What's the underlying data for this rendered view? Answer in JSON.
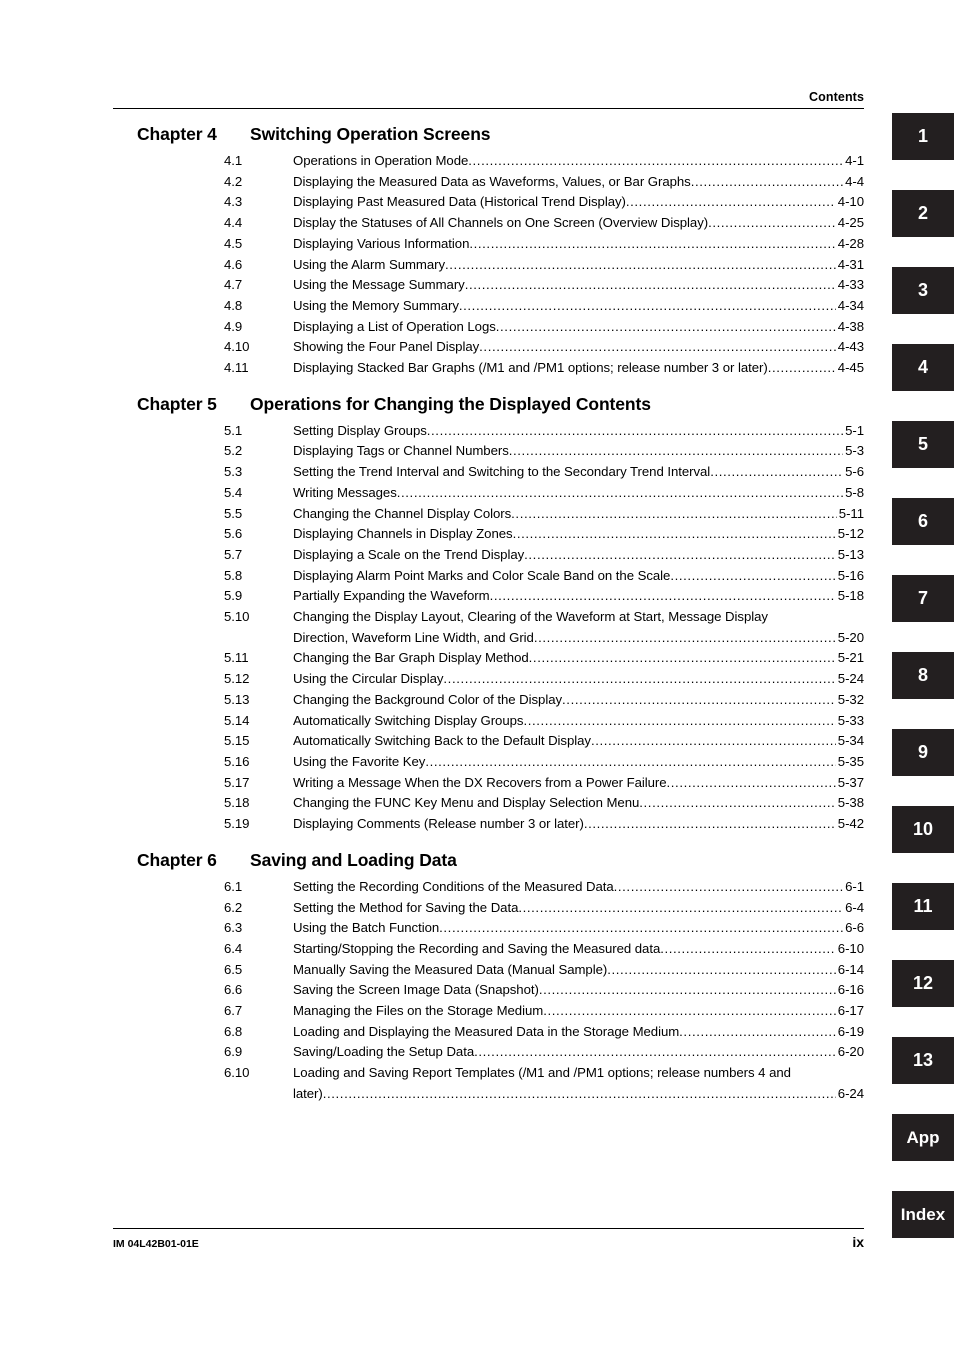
{
  "header": {
    "label": "Contents"
  },
  "footer": {
    "document_number": "IM 04L42B01-01E",
    "page_number": "ix"
  },
  "chapters": [
    {
      "number": "Chapter 4",
      "title": "Switching Operation Screens",
      "entries": [
        {
          "num": "4.1",
          "title": "Operations in Operation Mode",
          "page": "4-1"
        },
        {
          "num": "4.2",
          "title": "Displaying the Measured Data as Waveforms, Values, or Bar Graphs",
          "page": "4-4"
        },
        {
          "num": "4.3",
          "title": "Displaying Past Measured Data (Historical Trend Display)",
          "page": "4-10"
        },
        {
          "num": "4.4",
          "title": "Display the Statuses of All Channels on One Screen (Overview Display)",
          "page": "4-25"
        },
        {
          "num": "4.5",
          "title": "Displaying Various Information",
          "page": "4-28"
        },
        {
          "num": "4.6",
          "title": "Using the Alarm Summary",
          "page": "4-31"
        },
        {
          "num": "4.7",
          "title": "Using the Message Summary",
          "page": "4-33"
        },
        {
          "num": "4.8",
          "title": "Using the Memory Summary",
          "page": "4-34"
        },
        {
          "num": "4.9",
          "title": "Displaying a List of Operation Logs",
          "page": "4-38"
        },
        {
          "num": "4.10",
          "title": "Showing the Four Panel Display",
          "page": "4-43"
        },
        {
          "num": "4.11",
          "title": "Displaying Stacked Bar Graphs (/M1 and /PM1 options; release number 3 or later)",
          "page": "4-45"
        }
      ]
    },
    {
      "number": "Chapter 5",
      "title": "Operations for Changing the Displayed Contents",
      "entries": [
        {
          "num": "5.1",
          "title": "Setting Display Groups",
          "page": "5-1"
        },
        {
          "num": "5.2",
          "title": "Displaying Tags or Channel Numbers",
          "page": "5-3"
        },
        {
          "num": "5.3",
          "title": "Setting the Trend Interval and Switching to the Secondary Trend Interval",
          "page": "5-6"
        },
        {
          "num": "5.4",
          "title": "Writing Messages",
          "page": "5-8"
        },
        {
          "num": "5.5",
          "title": "Changing the Channel Display Colors",
          "page": "5-11"
        },
        {
          "num": "5.6",
          "title": "Displaying Channels in Display Zones",
          "page": "5-12"
        },
        {
          "num": "5.7",
          "title": "Displaying a Scale on the Trend Display",
          "page": "5-13"
        },
        {
          "num": "5.8",
          "title": "Displaying Alarm Point Marks and Color Scale Band on the Scale",
          "page": "5-16"
        },
        {
          "num": "5.9",
          "title": "Partially Expanding the Waveform",
          "page": "5-18"
        },
        {
          "num": "5.10",
          "title": "Changing the Display Layout, Clearing of the Waveform at Start, Message Display",
          "page": "",
          "wrap": "Direction, Waveform Line Width, and Grid",
          "wrap_page": "5-20"
        },
        {
          "num": "5.11",
          "title": "Changing the Bar Graph Display Method",
          "page": "5-21"
        },
        {
          "num": "5.12",
          "title": "Using the Circular Display",
          "page": "5-24"
        },
        {
          "num": "5.13",
          "title": "Changing the Background Color of the Display",
          "page": "5-32"
        },
        {
          "num": "5.14",
          "title": "Automatically Switching Display Groups",
          "page": "5-33"
        },
        {
          "num": "5.15",
          "title": "Automatically Switching Back to the Default Display",
          "page": "5-34"
        },
        {
          "num": "5.16",
          "title": "Using the Favorite Key",
          "page": "5-35"
        },
        {
          "num": "5.17",
          "title": "Writing a Message When the DX Recovers from a Power Failure",
          "page": "5-37"
        },
        {
          "num": "5.18",
          "title": "Changing the FUNC Key Menu and Display Selection Menu",
          "page": "5-38"
        },
        {
          "num": "5.19",
          "title": "Displaying Comments (Release number 3 or later)",
          "page": "5-42"
        }
      ]
    },
    {
      "number": "Chapter 6",
      "title": "Saving and Loading Data",
      "entries": [
        {
          "num": "6.1",
          "title": "Setting the Recording Conditions of the Measured Data",
          "page": "6-1"
        },
        {
          "num": "6.2",
          "title": "Setting the Method for Saving the Data",
          "page": "6-4"
        },
        {
          "num": "6.3",
          "title": "Using the Batch Function",
          "page": "6-6"
        },
        {
          "num": "6.4",
          "title": "Starting/Stopping the Recording and Saving the Measured data",
          "page": "6-10"
        },
        {
          "num": "6.5",
          "title": "Manually Saving the Measured Data (Manual Sample)",
          "page": "6-14"
        },
        {
          "num": "6.6",
          "title": "Saving the Screen Image Data (Snapshot)",
          "page": "6-16"
        },
        {
          "num": "6.7",
          "title": "Managing the Files on the Storage Medium",
          "page": "6-17"
        },
        {
          "num": "6.8",
          "title": "Loading and Displaying the Measured Data in the Storage Medium",
          "page": "6-19"
        },
        {
          "num": "6.9",
          "title": "Saving/Loading the Setup Data",
          "page": "6-20"
        },
        {
          "num": "6.10",
          "title": "Loading and Saving Report Templates (/M1 and /PM1 options; release numbers 4 and",
          "page": "",
          "wrap": "later)",
          "wrap_page": "6-24"
        }
      ]
    }
  ],
  "tabs": [
    {
      "label": "1"
    },
    {
      "label": "2"
    },
    {
      "label": "3"
    },
    {
      "label": "4"
    },
    {
      "label": "5"
    },
    {
      "label": "6"
    },
    {
      "label": "7"
    },
    {
      "label": "8"
    },
    {
      "label": "9"
    },
    {
      "label": "10"
    },
    {
      "label": "11"
    },
    {
      "label": "12"
    },
    {
      "label": "13"
    },
    {
      "label": "App"
    },
    {
      "label": "Index"
    }
  ]
}
